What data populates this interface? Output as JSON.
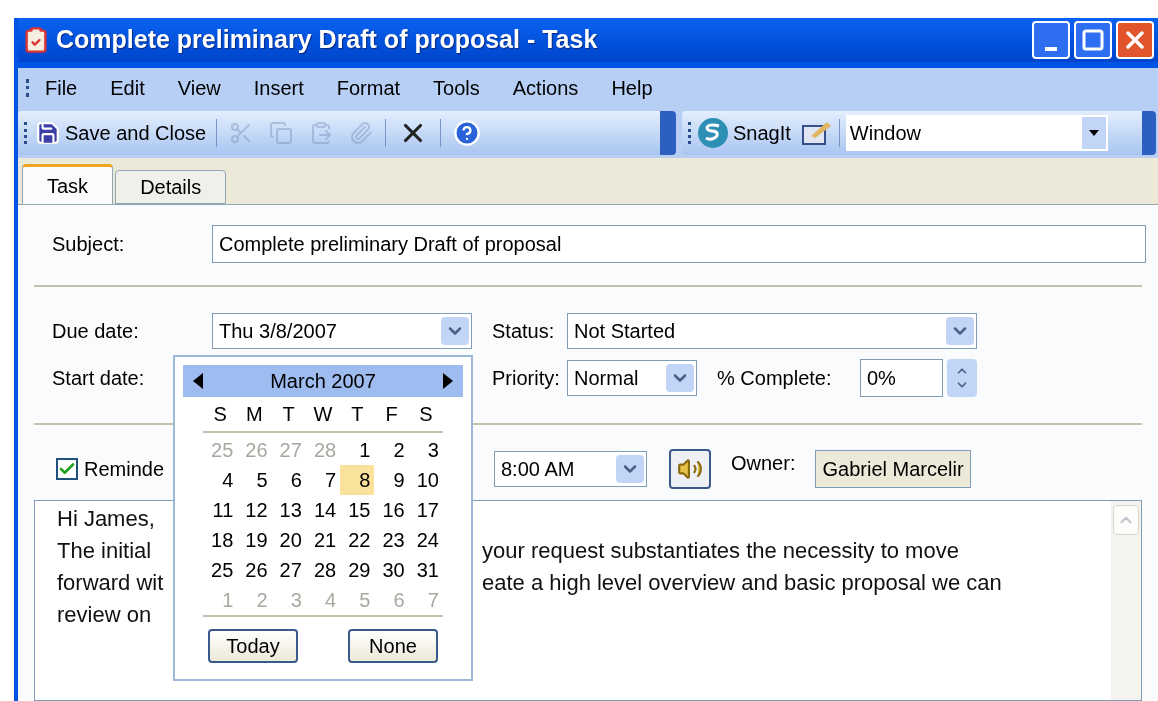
{
  "window": {
    "title": "Complete preliminary Draft of proposal - Task"
  },
  "menu": [
    "File",
    "Edit",
    "View",
    "Insert",
    "Format",
    "Tools",
    "Actions",
    "Help"
  ],
  "toolbar": [
    {
      "kind": "save",
      "label": "Save and Close",
      "disabled": false
    },
    {
      "kind": "separator"
    },
    {
      "kind": "cut",
      "disabled": true
    },
    {
      "kind": "copy",
      "disabled": true
    },
    {
      "kind": "paste",
      "disabled": true
    },
    {
      "kind": "attach",
      "disabled": true
    },
    {
      "kind": "separator"
    },
    {
      "kind": "delete",
      "disabled": false
    },
    {
      "kind": "separator"
    },
    {
      "kind": "help",
      "disabled": false
    }
  ],
  "snagit": {
    "label": "SnagIt",
    "profile": "Window"
  },
  "tabs": [
    {
      "label": "Task",
      "selected": true
    },
    {
      "label": "Details",
      "selected": false
    }
  ],
  "form": {
    "subject_label": "Subject:",
    "subject": "Complete preliminary Draft of proposal",
    "due_label": "Due date:",
    "due": "Thu 3/8/2007",
    "start_label": "Start date:",
    "status_label": "Status:",
    "status": "Not Started",
    "priority_label": "Priority:",
    "priority": "Normal",
    "complete_label": "% Complete:",
    "complete": "0%",
    "reminder_label": "Reminde",
    "reminder_checked": true,
    "reminder_time": "8:00 AM",
    "owner_label": "Owner:",
    "owner": "Gabriel Marcelir"
  },
  "body": [
    {
      "left": "Hi James,"
    },
    {
      "left": "The initial",
      "right": "your request substantiates the necessity to move"
    },
    {
      "left": "forward wit",
      "right": "eate a high level overview and basic proposal we can"
    },
    {
      "left": "review on"
    }
  ],
  "calendar": {
    "month": "March 2007",
    "weekdays": [
      "S",
      "M",
      "T",
      "W",
      "T",
      "F",
      "S"
    ],
    "weeks": [
      [
        {
          "day": "25",
          "other": true,
          "selected": false
        },
        {
          "day": "26",
          "other": true,
          "selected": false
        },
        {
          "day": "27",
          "other": true,
          "selected": false
        },
        {
          "day": "28",
          "other": true,
          "selected": false
        },
        {
          "day": "1",
          "other": false,
          "selected": false
        },
        {
          "day": "2",
          "other": false,
          "selected": false
        },
        {
          "day": "3",
          "other": false,
          "selected": false
        }
      ],
      [
        {
          "day": "4",
          "other": false,
          "selected": false
        },
        {
          "day": "5",
          "other": false,
          "selected": false
        },
        {
          "day": "6",
          "other": false,
          "selected": false
        },
        {
          "day": "7",
          "other": false,
          "selected": false
        },
        {
          "day": "8",
          "other": false,
          "selected": true
        },
        {
          "day": "9",
          "other": false,
          "selected": false
        },
        {
          "day": "10",
          "other": false,
          "selected": false
        }
      ],
      [
        {
          "day": "11",
          "other": false,
          "selected": false
        },
        {
          "day": "12",
          "other": false,
          "selected": false
        },
        {
          "day": "13",
          "other": false,
          "selected": false
        },
        {
          "day": "14",
          "other": false,
          "selected": false
        },
        {
          "day": "15",
          "other": false,
          "selected": false
        },
        {
          "day": "16",
          "other": false,
          "selected": false
        },
        {
          "day": "17",
          "other": false,
          "selected": false
        }
      ],
      [
        {
          "day": "18",
          "other": false,
          "selected": false
        },
        {
          "day": "19",
          "other": false,
          "selected": false
        },
        {
          "day": "20",
          "other": false,
          "selected": false
        },
        {
          "day": "21",
          "other": false,
          "selected": false
        },
        {
          "day": "22",
          "other": false,
          "selected": false
        },
        {
          "day": "23",
          "other": false,
          "selected": false
        },
        {
          "day": "24",
          "other": false,
          "selected": false
        }
      ],
      [
        {
          "day": "25",
          "other": false,
          "selected": false
        },
        {
          "day": "26",
          "other": false,
          "selected": false
        },
        {
          "day": "27",
          "other": false,
          "selected": false
        },
        {
          "day": "28",
          "other": false,
          "selected": false
        },
        {
          "day": "29",
          "other": false,
          "selected": false
        },
        {
          "day": "30",
          "other": false,
          "selected": false
        },
        {
          "day": "31",
          "other": false,
          "selected": false
        }
      ],
      [
        {
          "day": "1",
          "other": true,
          "selected": false
        },
        {
          "day": "2",
          "other": true,
          "selected": false
        },
        {
          "day": "3",
          "other": true,
          "selected": false
        },
        {
          "day": "4",
          "other": true,
          "selected": false
        },
        {
          "day": "5",
          "other": true,
          "selected": false
        },
        {
          "day": "6",
          "other": true,
          "selected": false
        },
        {
          "day": "7",
          "other": true,
          "selected": false
        }
      ]
    ],
    "buttons": [
      "Today",
      "None"
    ]
  }
}
